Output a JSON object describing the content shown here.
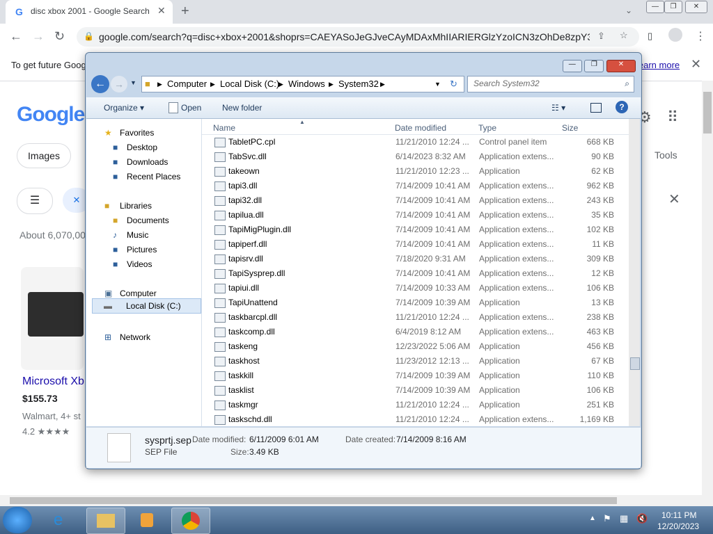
{
  "browser": {
    "tab_title": "disc xbox 2001 - Google Search",
    "url": "google.com/search?q=disc+xbox+2001&shoprs=CAEYASoJeGJveCAyMDAxMhIIARIERGlzYzoICN3zOhDe8zpY3O...",
    "infobar_text": "To get future Goog",
    "learn_more": "learn more",
    "window_min": "—",
    "window_max": "❐",
    "window_close": "✕"
  },
  "google": {
    "logo": "Google",
    "chip_images": "Images",
    "tools": "Tools",
    "about": "About 6,070,00",
    "product_title": "Microsoft Xb",
    "product_price": "$155.73",
    "product_store": "Walmart, 4+ st",
    "product_rating": "4.2 ★★★★"
  },
  "explorer": {
    "path": [
      "Computer",
      "Local Disk (C:)",
      "Windows",
      "System32"
    ],
    "search_placeholder": "Search System32",
    "commands": {
      "organize": "Organize ▾",
      "open": "Open",
      "new_folder": "New folder"
    },
    "nav": {
      "favorites": "Favorites",
      "desktop": "Desktop",
      "downloads": "Downloads",
      "recent": "Recent Places",
      "libraries": "Libraries",
      "documents": "Documents",
      "music": "Music",
      "pictures": "Pictures",
      "videos": "Videos",
      "computer": "Computer",
      "local_disk": "Local Disk (C:)",
      "network": "Network"
    },
    "columns": {
      "name": "Name",
      "date": "Date modified",
      "type": "Type",
      "size": "Size"
    },
    "files": [
      {
        "name": "TabletPC.cpl",
        "date": "11/21/2010 12:24 ...",
        "type": "Control panel item",
        "size": "668 KB"
      },
      {
        "name": "TabSvc.dll",
        "date": "6/14/2023 8:32 AM",
        "type": "Application extens...",
        "size": "90 KB"
      },
      {
        "name": "takeown",
        "date": "11/21/2010 12:23 ...",
        "type": "Application",
        "size": "62 KB"
      },
      {
        "name": "tapi3.dll",
        "date": "7/14/2009 10:41 AM",
        "type": "Application extens...",
        "size": "962 KB"
      },
      {
        "name": "tapi32.dll",
        "date": "7/14/2009 10:41 AM",
        "type": "Application extens...",
        "size": "243 KB"
      },
      {
        "name": "tapilua.dll",
        "date": "7/14/2009 10:41 AM",
        "type": "Application extens...",
        "size": "35 KB"
      },
      {
        "name": "TapiMigPlugin.dll",
        "date": "7/14/2009 10:41 AM",
        "type": "Application extens...",
        "size": "102 KB"
      },
      {
        "name": "tapiperf.dll",
        "date": "7/14/2009 10:41 AM",
        "type": "Application extens...",
        "size": "11 KB"
      },
      {
        "name": "tapisrv.dll",
        "date": "7/18/2020 9:31 AM",
        "type": "Application extens...",
        "size": "309 KB"
      },
      {
        "name": "TapiSysprep.dll",
        "date": "7/14/2009 10:41 AM",
        "type": "Application extens...",
        "size": "12 KB"
      },
      {
        "name": "tapiui.dll",
        "date": "7/14/2009 10:33 AM",
        "type": "Application extens...",
        "size": "106 KB"
      },
      {
        "name": "TapiUnattend",
        "date": "7/14/2009 10:39 AM",
        "type": "Application",
        "size": "13 KB"
      },
      {
        "name": "taskbarcpl.dll",
        "date": "11/21/2010 12:24 ...",
        "type": "Application extens...",
        "size": "238 KB"
      },
      {
        "name": "taskcomp.dll",
        "date": "6/4/2019 8:12 AM",
        "type": "Application extens...",
        "size": "463 KB"
      },
      {
        "name": "taskeng",
        "date": "12/23/2022 5:06 AM",
        "type": "Application",
        "size": "456 KB"
      },
      {
        "name": "taskhost",
        "date": "11/23/2012 12:13 ...",
        "type": "Application",
        "size": "67 KB"
      },
      {
        "name": "taskkill",
        "date": "7/14/2009 10:39 AM",
        "type": "Application",
        "size": "110 KB"
      },
      {
        "name": "tasklist",
        "date": "7/14/2009 10:39 AM",
        "type": "Application",
        "size": "106 KB"
      },
      {
        "name": "taskmgr",
        "date": "11/21/2010 12:24 ...",
        "type": "Application",
        "size": "251 KB"
      },
      {
        "name": "taskschd.dll",
        "date": "11/21/2010 12:24 ...",
        "type": "Application extens...",
        "size": "1,169 KB"
      }
    ],
    "details": {
      "filename": "sysprtj.sep",
      "filetype": "SEP File",
      "modified_label": "Date modified:",
      "modified": "6/11/2009 6:01 AM",
      "created_label": "Date created:",
      "created": "7/14/2009 8:16 AM",
      "size_label": "Size:",
      "size": "3.49 KB"
    }
  },
  "taskbar": {
    "time": "10:11 PM",
    "date": "12/20/2023"
  }
}
